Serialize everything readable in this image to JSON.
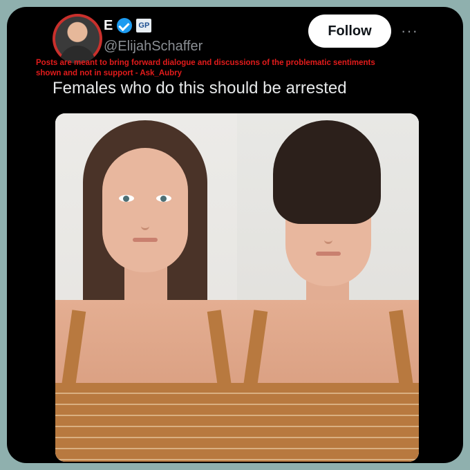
{
  "post": {
    "display_name": "E",
    "badge_text": "GP",
    "handle": "@ElijahSchaffer",
    "follow_label": "Follow",
    "more_label": "···",
    "disclaimer": "Posts are meant to bring forward dialogue and discussions of the problematic sentiments shown and not in support - Ask_Aubry",
    "text": "Females who do this should be arrested"
  },
  "icons": {
    "verified": "verified-check-icon",
    "more": "more-options-icon"
  },
  "colors": {
    "background": "#000000",
    "outer": "#8fb0ae",
    "verified": "#1d9bf0",
    "disclaimer": "#e31b1b",
    "handle": "#8b8f94"
  }
}
